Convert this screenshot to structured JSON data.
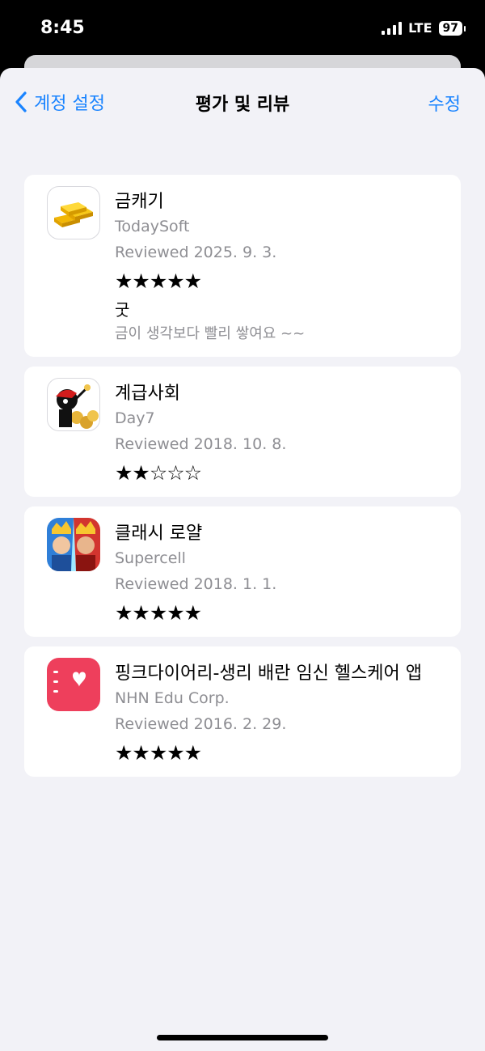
{
  "status_bar": {
    "time": "8:45",
    "network": "LTE",
    "battery": "97"
  },
  "nav": {
    "back_label": "계정 설정",
    "title": "평가 및 리뷰",
    "edit_label": "수정"
  },
  "reviews": [
    {
      "app_name": "금캐기",
      "developer": "TodaySoft",
      "date": "Reviewed 2025. 9. 3.",
      "stars": "★★★★★",
      "rating": 5,
      "title": "굿",
      "body": "금이 생각보다 빨리 쌓여요 ~~"
    },
    {
      "app_name": "계급사회",
      "developer": "Day7",
      "date": "Reviewed 2018. 10. 8.",
      "stars": "★★☆☆☆",
      "rating": 2
    },
    {
      "app_name": "클래시 로얄",
      "developer": "Supercell",
      "date": "Reviewed 2018. 1. 1.",
      "stars": "★★★★★",
      "rating": 5
    },
    {
      "app_name": "핑크다이어리-생리 배란 임신 헬스케어 앱",
      "developer": "NHN Edu Corp.",
      "date": "Reviewed 2016. 2. 29.",
      "stars": "★★★★★",
      "rating": 5
    }
  ],
  "colors": {
    "accent": "#1a84ff",
    "background": "#f2f2f7",
    "secondary_text": "#8e8e93"
  }
}
